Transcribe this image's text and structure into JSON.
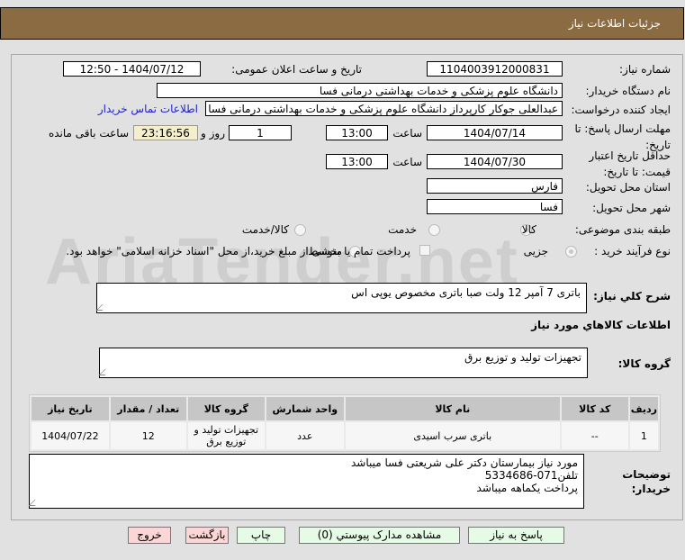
{
  "header": {
    "title": "جزئیات اطلاعات نیاز"
  },
  "watermark": "AriaTender.net",
  "fields": {
    "need_number_label": "شماره نیاز:",
    "need_number": "1104003912000831",
    "announce_label": "تاریخ و ساعت اعلان عمومی:",
    "announce_value": "1404/07/12 - 12:50",
    "buyer_org_label": "نام دستگاه خریدار:",
    "buyer_org": "دانشگاه علوم پزشکی و خدمات بهداشتی درمانی فسا",
    "creator_label": "ایجاد کننده درخواست:",
    "creator": "عبدالعلی جوکار کارپرداز دانشگاه علوم پزشکی و خدمات بهداشتی درمانی فسا",
    "contact_link": "اطلاعات تماس خریدار",
    "deadline_label_1": "مهلت ارسال پاسخ: تا",
    "deadline_label_2": "تاریخ:",
    "deadline_date": "1404/07/14",
    "time_label": "ساعت",
    "deadline_time": "13:00",
    "days": "1",
    "days_label": "روز و",
    "remaining": "23:16:56",
    "remaining_label": "ساعت باقی مانده",
    "validity_label_1": "حداقل تاریخ اعتبار",
    "validity_label_2": "قیمت: تا تاریخ:",
    "validity_date": "1404/07/30",
    "validity_time": "13:00",
    "province_label": "استان محل تحویل:",
    "province": "فارس",
    "city_label": "شهر محل تحویل:",
    "city": "فسا",
    "category_label": "طبقه بندی موضوعی:",
    "category_options": [
      "کالا",
      "خدمت",
      "کالا/خدمت"
    ],
    "process_label": "نوع فرآیند خرید :",
    "process_options": [
      "جزیی",
      "متوسط"
    ],
    "payment_note": "پرداخت تمام یا بخشی از مبلغ خرید،از محل \"اسناد خزانه اسلامی\" خواهد بود.",
    "description_label": "شرح کلي نیاز:",
    "description": "باتری 7 آمپر 12 ولت صبا باتری مخصوص یوپی اس",
    "goods_info_title": "اطلاعات کالاهاي مورد نیاز",
    "goods_group_label": "گروه کالا:",
    "goods_group": "تجهیزات تولید و توزیع برق",
    "buyer_notes_label_1": "توضیحات",
    "buyer_notes_label_2": "خریدار:",
    "buyer_notes": [
      "مورد نیاز بیمارستان دکتر علی شریعتی فسا میباشد",
      "تلفن071-5334686",
      "پرداخت یکماهه میباشد"
    ]
  },
  "table": {
    "headers": [
      "ردیف",
      "کد کالا",
      "نام کالا",
      "واحد شمارش",
      "گروه کالا",
      "تعداد / مقدار",
      "تاریخ نیاز"
    ],
    "rows": [
      [
        "1",
        "--",
        "باتری سرب اسیدی",
        "عدد",
        "تجهیزات تولید و توزیع برق",
        "12",
        "1404/07/22"
      ]
    ]
  },
  "buttons": {
    "reply": "پاسخ به نیاز",
    "attachments": "مشاهده مدارک پیوستي (0)",
    "print": "چاپ",
    "back": "بازگشت",
    "exit": "خروج"
  }
}
